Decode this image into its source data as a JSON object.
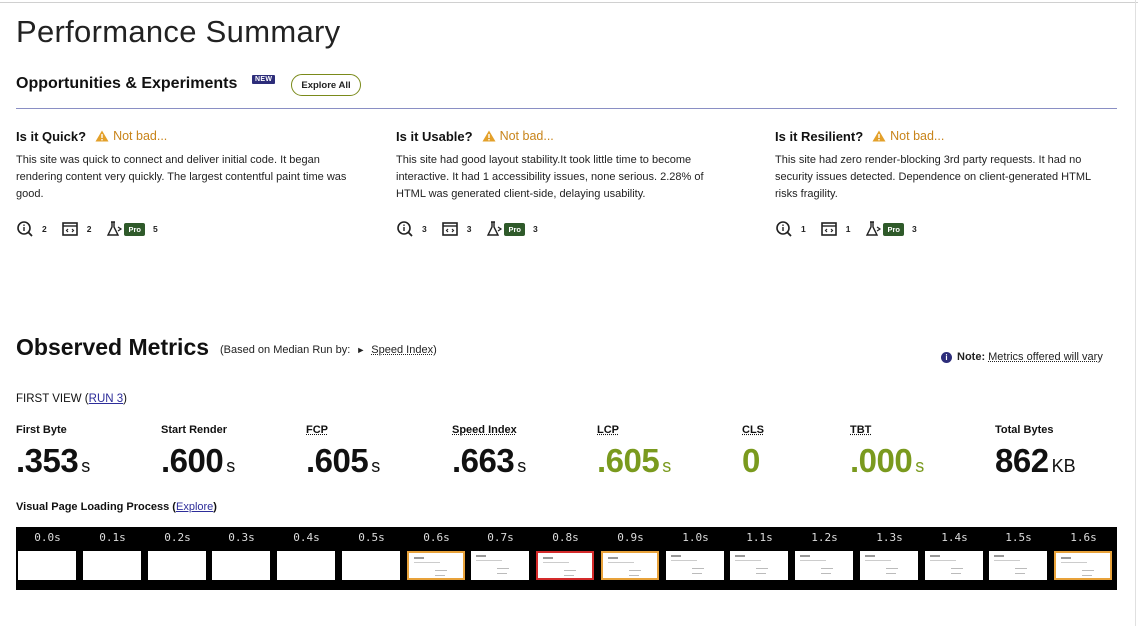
{
  "page_title": "Performance Summary",
  "opportunities": {
    "title": "Opportunities & Experiments",
    "new_badge": "NEW",
    "explore_all_label": "Explore All"
  },
  "columns": [
    {
      "heading": "Is it Quick?",
      "status": "Not bad...",
      "description": "This site was quick to connect and deliver initial code. It began rendering content very quickly. The largest contentful paint time was good.",
      "counts": {
        "info": "2",
        "screen": "2",
        "pro": "5"
      },
      "pro_label": "Pro"
    },
    {
      "heading": "Is it Usable?",
      "status": "Not bad...",
      "description": "This site had good layout stability.It took little time to become interactive. It had 1 accessibility issues, none serious. 2.28% of HTML was generated client-side, delaying usability.",
      "counts": {
        "info": "3",
        "screen": "3",
        "pro": "3"
      },
      "pro_label": "Pro"
    },
    {
      "heading": "Is it Resilient?",
      "status": "Not bad...",
      "description": "This site had zero render-blocking 3rd party requests. It had no security issues detected. Dependence on client-generated HTML risks fragility.",
      "counts": {
        "info": "1",
        "screen": "1",
        "pro": "3"
      },
      "pro_label": "Pro"
    }
  ],
  "observed": {
    "title": "Observed Metrics",
    "subtitle_prefix": "(Based on Median Run by:",
    "subtitle_link": "Speed Index",
    "subtitle_suffix": ")",
    "note_label": "Note:",
    "note_text": "Metrics offered will vary",
    "first_view_label": "FIRST VIEW",
    "run_link": "RUN 3"
  },
  "metrics": [
    {
      "label": "First Byte",
      "value": ".353",
      "unit": "s"
    },
    {
      "label": "Start Render",
      "value": ".600",
      "unit": "s"
    },
    {
      "label": "FCP",
      "value": ".605",
      "unit": "s"
    },
    {
      "label": "Speed Index",
      "value": ".663",
      "unit": "s"
    },
    {
      "label": "LCP",
      "value": ".605",
      "unit": "s"
    },
    {
      "label": "CLS",
      "value": "0",
      "unit": ""
    },
    {
      "label": "TBT",
      "value": ".000",
      "unit": "s"
    },
    {
      "label": "Total Bytes",
      "value": "862",
      "unit": "KB"
    }
  ],
  "visual": {
    "title": "Visual Page Loading Process",
    "explore_link": "Explore",
    "frames": [
      "0.0s",
      "0.1s",
      "0.2s",
      "0.3s",
      "0.4s",
      "0.5s",
      "0.6s",
      "0.7s",
      "0.8s",
      "0.9s",
      "1.0s",
      "1.1s",
      "1.2s",
      "1.3s",
      "1.4s",
      "1.5s",
      "1.6s"
    ]
  },
  "colors": {
    "accent_green": "#7a9a1e",
    "warning": "#c8841a",
    "link": "#2d2d9a",
    "badge_navy": "#2d2d7a",
    "frame_orange": "#e8a23a",
    "frame_red": "#d42a2a"
  },
  "icons": [
    "warning-icon",
    "info-search-icon",
    "screen-code-icon",
    "experiment-flask-icon",
    "info-icon",
    "play-triangle-icon"
  ]
}
